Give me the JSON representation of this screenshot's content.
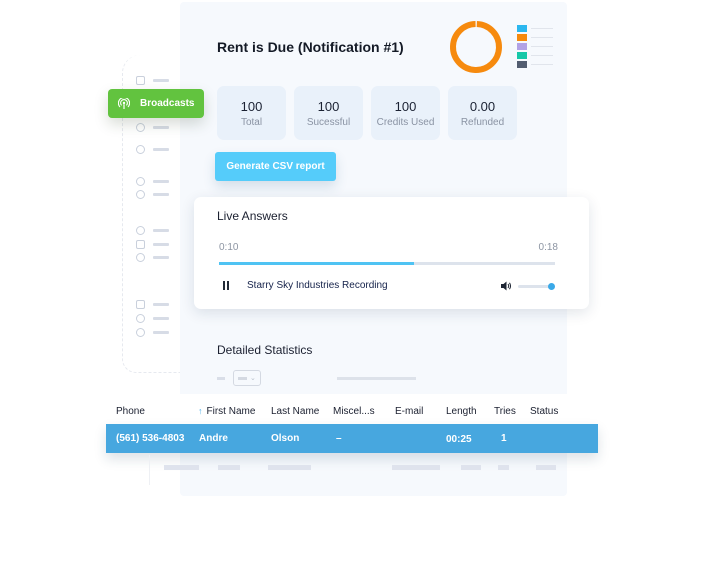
{
  "header": {
    "title": "Rent is Due (Notification #1)"
  },
  "donut_legend_colors": [
    "#2bb7ef",
    "#f68a0e",
    "#b2a2e6",
    "#16c8a8",
    "#525d70"
  ],
  "donut_color": "#f68a0e",
  "sidebar": {
    "active_item": {
      "label": "Broadcasts",
      "icon": "broadcast-icon"
    },
    "icons": [
      "grid-icon",
      "users-icon",
      "mic-icon",
      "chat-icon",
      "voicemail-icon",
      "phone-icon",
      "box-icon",
      "hierarchy-icon",
      "logout-icon",
      "support-icon",
      "settings-icon"
    ]
  },
  "stats": [
    {
      "value": "100",
      "label": "Total"
    },
    {
      "value": "100",
      "label": "Sucessful"
    },
    {
      "value": "100",
      "label": "Credits Used"
    },
    {
      "value": "0.00",
      "label": "Refunded"
    }
  ],
  "actions": {
    "csv_label": "Generate CSV report"
  },
  "live_answers": {
    "title": "Live Answers",
    "time_current": "0:10",
    "time_total": "0:18",
    "progress_fraction": 0.58,
    "track_name": "Starry Sky Industries Recording",
    "volume_fraction": 1.0
  },
  "detailed_statistics": {
    "title": "Detailed Statistics",
    "columns": [
      "Phone",
      "First Name",
      "Last Name",
      "Miscel...s",
      "E-mail",
      "Length",
      "Tries",
      "Status"
    ],
    "sorted_column": "First Name",
    "selected_row": {
      "phone": "(561) 536-4803",
      "first_name": "Andre",
      "last_name": "Olson",
      "misc": "–",
      "email": "",
      "length": "00:25",
      "tries": "1",
      "status": ""
    }
  }
}
